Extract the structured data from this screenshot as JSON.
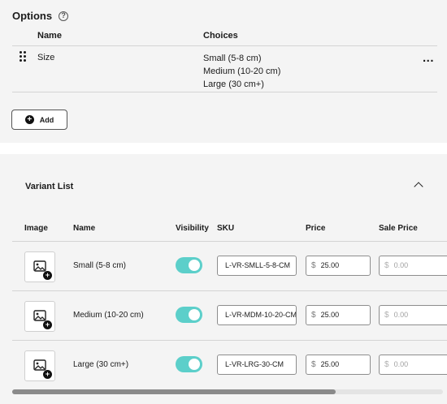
{
  "options": {
    "title": "Options",
    "help_icon": "?",
    "columns": {
      "name": "Name",
      "choices": "Choices"
    },
    "rows": [
      {
        "name": "Size",
        "choices": [
          "Small (5-8 cm)",
          "Medium (10-20 cm)",
          "Large (30 cm+)"
        ],
        "more": "..."
      }
    ],
    "add_label": "Add",
    "add_icon": "+"
  },
  "variants": {
    "title": "Variant List",
    "columns": {
      "image": "Image",
      "name": "Name",
      "visibility": "Visibility",
      "sku": "SKU",
      "price": "Price",
      "sale_price": "Sale Price"
    },
    "currency": "$",
    "rows": [
      {
        "name": "Small (5-8 cm)",
        "visible": true,
        "sku": "L-VR-SMLL-5-8-CM",
        "price": "25.00",
        "sale_placeholder": "0.00"
      },
      {
        "name": "Medium (10-20 cm)",
        "visible": true,
        "sku": "L-VR-MDM-10-20-CM",
        "price": "25.00",
        "sale_placeholder": "0.00"
      },
      {
        "name": "Large (30 cm+)",
        "visible": true,
        "sku": "L-VR-LRG-30-CM",
        "price": "25.00",
        "sale_placeholder": "0.00"
      }
    ],
    "toggle_color": "#5ccfca",
    "horizontal_scroll_progress": 0.75
  }
}
